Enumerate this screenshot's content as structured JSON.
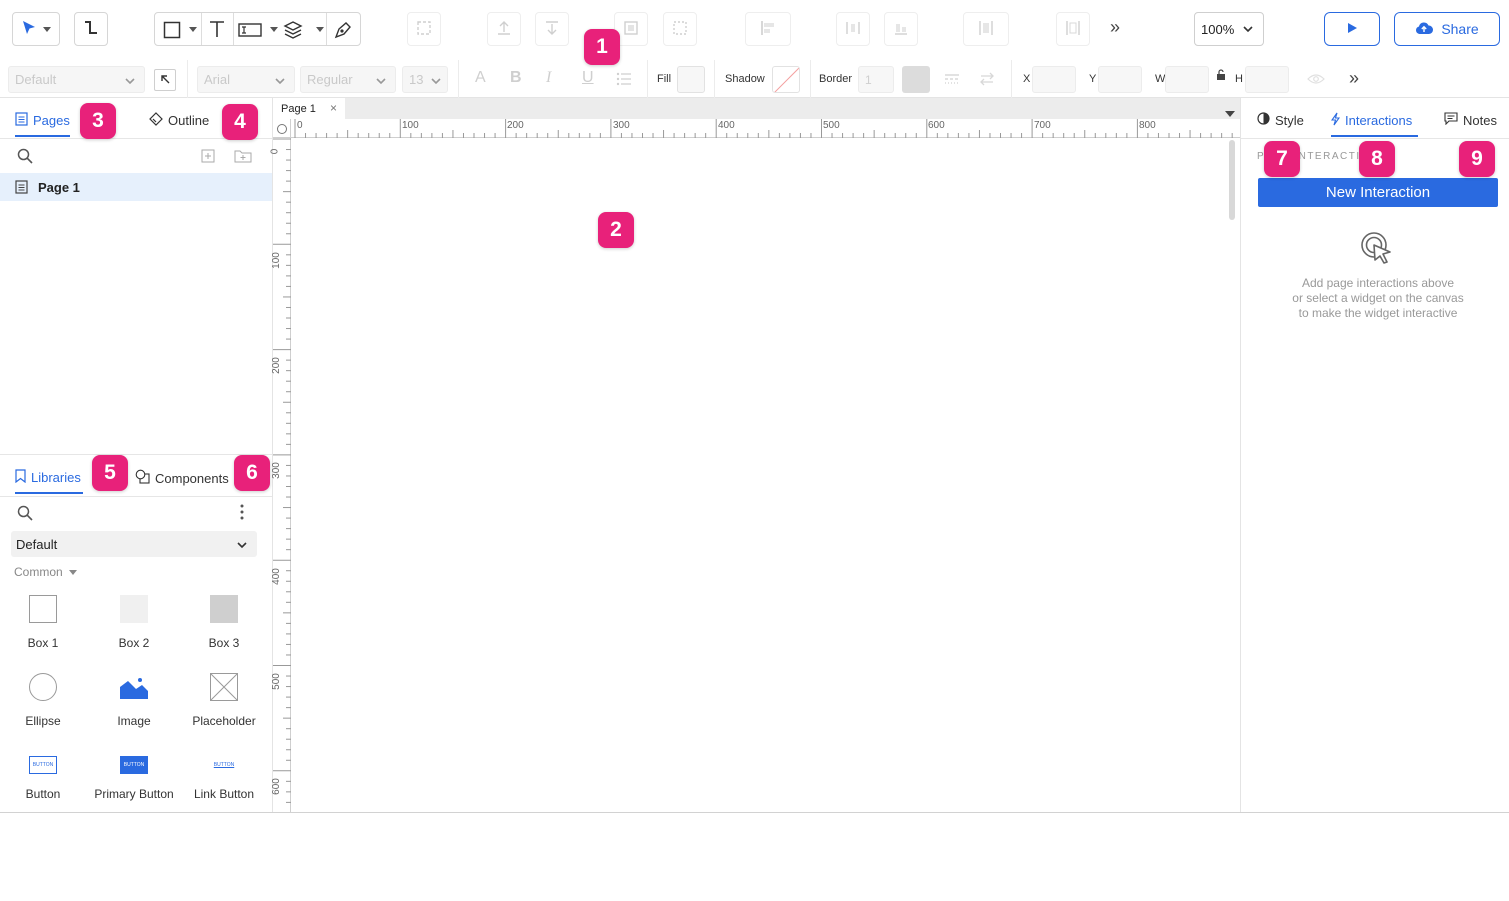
{
  "toolbar": {
    "zoom_value": "100%",
    "share_label": "Share",
    "more_label": "»"
  },
  "formatbar": {
    "style_select": "Default",
    "font_select": "Arial",
    "weight_select": "Regular",
    "size_select": "13",
    "fill_label": "Fill",
    "shadow_label": "Shadow",
    "border_label": "Border",
    "border_value": "1",
    "x_label": "X",
    "y_label": "Y",
    "w_label": "W",
    "h_label": "H",
    "more_label": "»"
  },
  "left_panel": {
    "pages_tab": "Pages",
    "outline_tab": "Outline",
    "pages": [
      "Page 1"
    ],
    "libraries_tab": "Libraries",
    "components_tab": "Components",
    "library_select": "Default",
    "group_label": "Common",
    "widgets": [
      "Box 1",
      "Box 2",
      "Box 3",
      "Ellipse",
      "Image",
      "Placeholder",
      "Button",
      "Primary Button",
      "Link Button"
    ],
    "button_widget_text": "BUTTON"
  },
  "canvas": {
    "page_tab": "Page 1",
    "close_glyph": "×",
    "ruler_top_labels": [
      "0",
      "100",
      "200",
      "300",
      "400",
      "500",
      "600",
      "700",
      "800"
    ],
    "ruler_left_labels": [
      "0",
      "100",
      "200",
      "300",
      "400",
      "500",
      "600"
    ]
  },
  "right_panel": {
    "style_tab": "Style",
    "interactions_tab": "Interactions",
    "notes_tab": "Notes",
    "section_label": "PAGE INTERACTIONS",
    "new_interaction_label": "New Interaction",
    "help_text_1": "Add page interactions above",
    "help_text_2": "or select a widget on the canvas",
    "help_text_3": "to make the widget interactive"
  },
  "callouts": [
    "1",
    "2",
    "3",
    "4",
    "5",
    "6",
    "7",
    "8",
    "9"
  ],
  "colors": {
    "accent": "#2a6ae0",
    "badge": "#e8217a",
    "selected_row": "#e6f0fc"
  }
}
